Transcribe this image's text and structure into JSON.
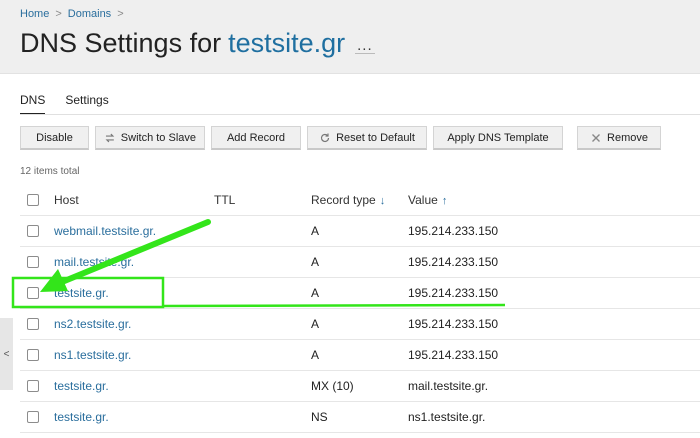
{
  "breadcrumb": {
    "home": "Home",
    "domains": "Domains",
    "separator": ">"
  },
  "title": {
    "prefix": "DNS Settings for",
    "domain": "testsite.gr",
    "menu": "..."
  },
  "tabs": [
    {
      "label": "DNS",
      "active": true
    },
    {
      "label": "Settings",
      "active": false
    }
  ],
  "toolbar": {
    "disable": "Disable",
    "switch_to_slave": "Switch to Slave",
    "add_record": "Add Record",
    "reset_to_default": "Reset to Default",
    "apply_dns_template": "Apply DNS Template",
    "remove": "Remove"
  },
  "items_total": "12 items total",
  "table": {
    "headers": {
      "host": "Host",
      "ttl": "TTL",
      "record_type": "Record type",
      "record_type_sort": "↓",
      "value": "Value",
      "value_sort": "↑"
    },
    "rows": [
      {
        "host": "webmail.testsite.gr.",
        "ttl": "",
        "type": "A",
        "value": "195.214.233.150"
      },
      {
        "host": "mail.testsite.gr.",
        "ttl": "",
        "type": "A",
        "value": "195.214.233.150"
      },
      {
        "host": "testsite.gr.",
        "ttl": "",
        "type": "A",
        "value": "195.214.233.150"
      },
      {
        "host": "ns2.testsite.gr.",
        "ttl": "",
        "type": "A",
        "value": "195.214.233.150"
      },
      {
        "host": "ns1.testsite.gr.",
        "ttl": "",
        "type": "A",
        "value": "195.214.233.150"
      },
      {
        "host": "testsite.gr.",
        "ttl": "",
        "type": "MX (10)",
        "value": "mail.testsite.gr."
      },
      {
        "host": "testsite.gr.",
        "ttl": "",
        "type": "NS",
        "value": "ns1.testsite.gr."
      }
    ]
  },
  "collapse_handle": {
    "glyph": "<"
  },
  "colors": {
    "link": "#2a6e9d",
    "annotation": "#33e51a",
    "header_bg": "#efefef"
  }
}
